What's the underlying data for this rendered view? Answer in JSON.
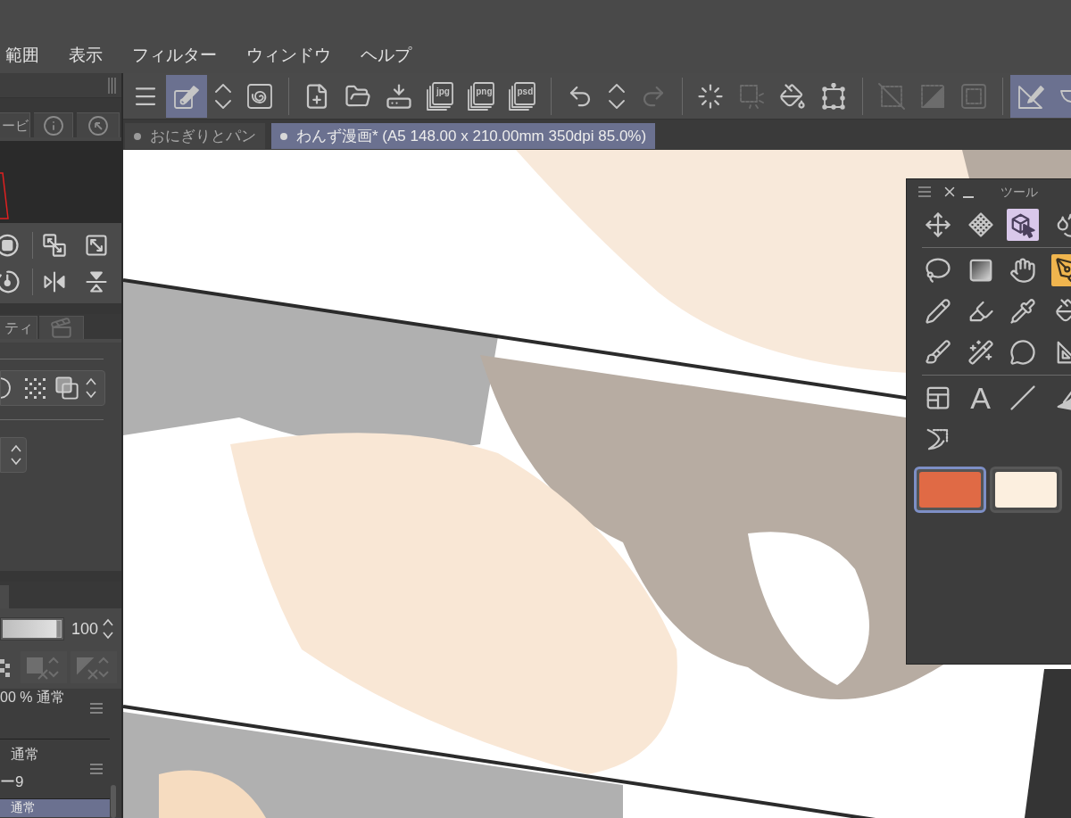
{
  "menu": [
    {
      "label": "範囲"
    },
    {
      "label": "表示"
    },
    {
      "label": "フィルター"
    },
    {
      "label": "ウィンドウ"
    },
    {
      "label": "ヘルプ"
    }
  ],
  "toolbar": [
    [
      {
        "kind": "menu",
        "selected": false,
        "disabled": false
      },
      {
        "kind": "pen-toggle",
        "selected": true,
        "disabled": false
      },
      {
        "kind": "updown",
        "selected": false,
        "disabled": false
      },
      {
        "kind": "swirl",
        "selected": false,
        "disabled": false
      }
    ],
    [
      {
        "kind": "new",
        "selected": false,
        "disabled": false
      },
      {
        "kind": "open",
        "selected": false,
        "disabled": false
      },
      {
        "kind": "import",
        "selected": false,
        "disabled": false
      },
      {
        "kind": "export",
        "label": "jpg",
        "selected": false,
        "disabled": false
      },
      {
        "kind": "export",
        "label": "png",
        "selected": false,
        "disabled": false
      },
      {
        "kind": "export",
        "label": "psd",
        "selected": false,
        "disabled": false
      }
    ],
    [
      {
        "kind": "undo",
        "selected": false,
        "disabled": false
      },
      {
        "kind": "updown",
        "selected": false,
        "disabled": false
      },
      {
        "kind": "redo",
        "selected": false,
        "disabled": true
      }
    ],
    [
      {
        "kind": "spinner",
        "selected": false,
        "disabled": false
      },
      {
        "kind": "select-fade",
        "selected": false,
        "disabled": true
      },
      {
        "kind": "fill",
        "selected": false,
        "disabled": false
      },
      {
        "kind": "transform",
        "selected": false,
        "disabled": false
      }
    ],
    [
      {
        "kind": "clear",
        "selected": false,
        "disabled": true
      },
      {
        "kind": "invert",
        "selected": false,
        "disabled": true
      },
      {
        "kind": "frame",
        "selected": false,
        "disabled": true
      }
    ],
    [
      {
        "kind": "ruler",
        "selected": true,
        "disabled": false
      },
      {
        "kind": "bowl",
        "selected": true,
        "disabled": false
      }
    ]
  ],
  "documents": [
    {
      "title": "おにぎりとパン",
      "selected": false
    },
    {
      "title": "わんず漫画* (A5 148.00 x 210.00mm 350dpi 85.0%)",
      "selected": true
    }
  ],
  "left_panel": {
    "nav_tabs": [
      {
        "kind": "text",
        "label": "ービ"
      },
      {
        "kind": "info"
      },
      {
        "kind": "cursor"
      }
    ],
    "property_tabs": [
      {
        "kind": "text",
        "label": "ティ"
      },
      {
        "kind": "animation"
      }
    ],
    "opacity": {
      "value": "100",
      "level": 1
    },
    "layers": [
      {
        "lines": [
          "00 % 通常"
        ],
        "selected": false
      },
      {
        "lines": [
          "通常",
          "ー9"
        ],
        "selected": false
      },
      {
        "lines": [
          "通常"
        ],
        "selected": true
      }
    ]
  },
  "tool_palette": {
    "title": "ツール",
    "sections": [
      [
        [
          {
            "kind": "move",
            "selected": false,
            "highlighted": false
          },
          {
            "kind": "mesh",
            "selected": false,
            "highlighted": false
          },
          {
            "kind": "cube",
            "selected": false,
            "highlighted": true
          },
          {
            "kind": "blend",
            "selected": false,
            "highlighted": false
          }
        ]
      ],
      [
        [
          {
            "kind": "lasso",
            "selected": false,
            "highlighted": false
          },
          {
            "kind": "gradient",
            "selected": false,
            "highlighted": false
          },
          {
            "kind": "hand",
            "selected": false,
            "highlighted": false
          },
          {
            "kind": "pen",
            "selected": true,
            "highlighted": false
          }
        ],
        [
          {
            "kind": "pencil",
            "selected": false,
            "highlighted": false
          },
          {
            "kind": "marker",
            "selected": false,
            "highlighted": false
          },
          {
            "kind": "dropper",
            "selected": false,
            "highlighted": false
          },
          {
            "kind": "fill",
            "selected": false,
            "highlighted": false
          }
        ],
        [
          {
            "kind": "inkpen",
            "selected": false,
            "highlighted": false
          },
          {
            "kind": "wand",
            "selected": false,
            "highlighted": false
          },
          {
            "kind": "bubble",
            "selected": false,
            "highlighted": false
          },
          {
            "kind": "ruler",
            "selected": false,
            "highlighted": false
          }
        ]
      ],
      [
        [
          {
            "kind": "frame",
            "selected": false,
            "highlighted": false
          },
          {
            "kind": "text",
            "label": "A",
            "selected": false,
            "highlighted": false
          },
          {
            "kind": "line",
            "selected": false,
            "highlighted": false
          },
          {
            "kind": "penruler",
            "selected": false,
            "highlighted": false
          }
        ],
        [
          {
            "kind": "tail",
            "selected": false,
            "highlighted": false
          }
        ]
      ]
    ],
    "colors": [
      {
        "color": "#e06a45",
        "selected": true
      },
      {
        "color": "#fcefdf",
        "selected": false
      }
    ]
  }
}
